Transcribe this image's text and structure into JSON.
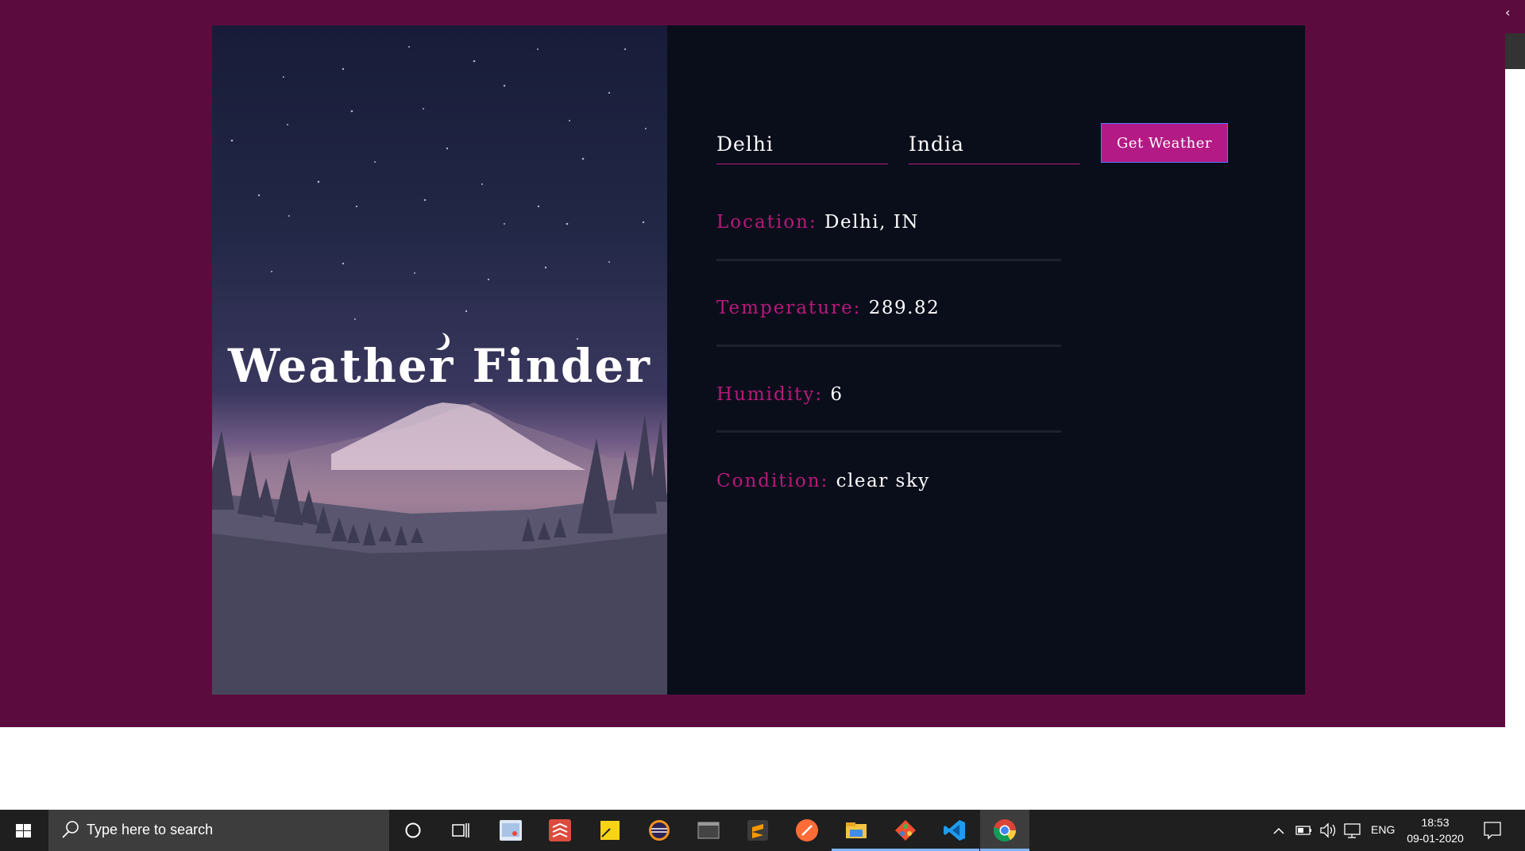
{
  "app": {
    "title": "Weather Finder"
  },
  "form": {
    "city_value": "Delhi",
    "country_value": "India",
    "submit_label": "Get Weather"
  },
  "results": {
    "location_label": "Location:",
    "location_value": "Delhi, IN",
    "temperature_label": "Temperature:",
    "temperature_value": "289.82",
    "humidity_label": "Humidity:",
    "humidity_value": "6",
    "condition_label": "Condition:",
    "condition_value": "clear sky"
  },
  "colors": {
    "page_bg": "#5c0b3f",
    "panel_bg": "#0a0e1b",
    "accent": "#b7197a",
    "button_bg": "#b41a85"
  },
  "taskbar": {
    "search_placeholder": "Type here to search",
    "pinned": [
      "cortana-icon",
      "task-view-icon",
      "paint-icon",
      "todoist-icon",
      "sticky-notes-icon",
      "eclipse-icon",
      "terminal-icon",
      "sublime-text-icon",
      "postman-icon",
      "file-explorer-icon",
      "git-icon",
      "vscode-icon",
      "chrome-icon"
    ],
    "language": "ENG",
    "time": "18:53",
    "date": "09-01-2020"
  }
}
